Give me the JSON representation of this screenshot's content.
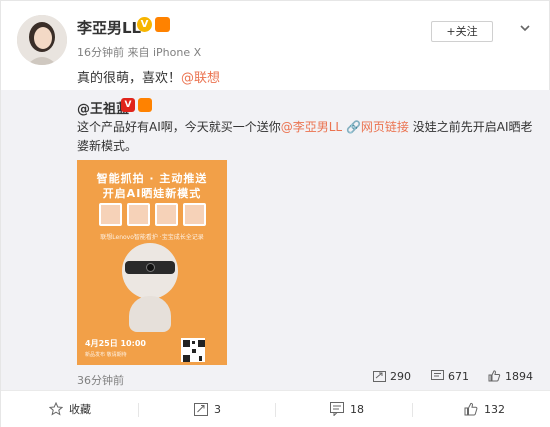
{
  "post": {
    "author": "李亞男LL",
    "time": "16分钟前",
    "source": "来自 iPhone X",
    "text_prefix": "真的很萌，喜欢！",
    "mention": "@联想",
    "follow_label": "+关注"
  },
  "repost": {
    "author": "@王祖蓝",
    "text_part1": "这个产品好有AI啊，今天就买一个送你",
    "mention": "@李亞男LL",
    "link_label": "网页链接",
    "text_part2": " 没娃之前先开启AI晒老婆新模式。",
    "time": "36分钟前",
    "reposts": "290",
    "comments": "671",
    "likes": "1894",
    "poster": {
      "line1": "智能抓拍 · 主动推送",
      "line2": "开启AI晒娃新模式",
      "small": "联想Lenovo智能看护 ·宝宝成长全记录",
      "date": "4月25日  10:00",
      "sub": "新品发布 敬请期待"
    }
  },
  "actions": {
    "favorite": "收藏",
    "repost": "3",
    "comment": "18",
    "like": "132"
  },
  "colors": {
    "accent": "#eb7350",
    "orange": "#ff8200",
    "poster_bg": "#f2a048",
    "repost_bg": "#f2f2f5"
  }
}
